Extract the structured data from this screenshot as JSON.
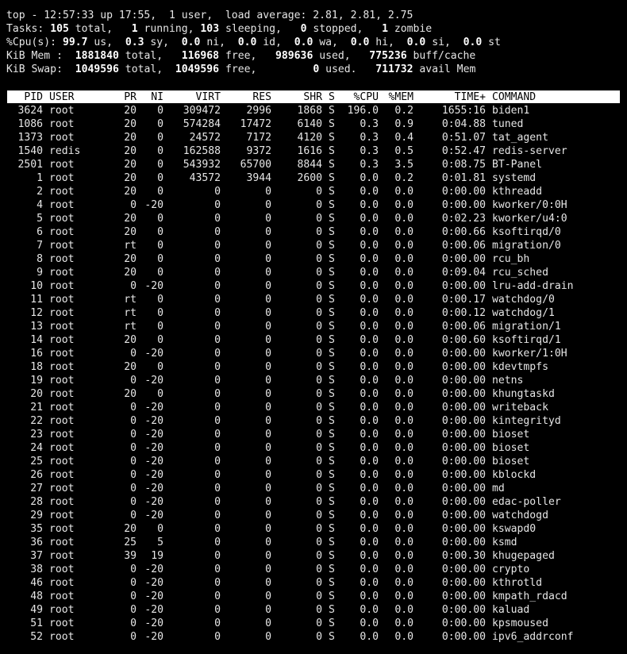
{
  "summary": {
    "line1": [
      {
        "t": "top - 12:57:33 up 17:55,  1 user,  load average: 2.81, 2.81, 2.75",
        "b": false
      }
    ],
    "line2": [
      {
        "t": "Tasks: ",
        "b": false
      },
      {
        "t": "105",
        "b": true
      },
      {
        "t": " total,   ",
        "b": false
      },
      {
        "t": "1",
        "b": true
      },
      {
        "t": " running, ",
        "b": false
      },
      {
        "t": "103",
        "b": true
      },
      {
        "t": " sleeping,   ",
        "b": false
      },
      {
        "t": "0",
        "b": true
      },
      {
        "t": " stopped,   ",
        "b": false
      },
      {
        "t": "1",
        "b": true
      },
      {
        "t": " zombie",
        "b": false
      }
    ],
    "line3": [
      {
        "t": "%Cpu(s): ",
        "b": false
      },
      {
        "t": "99.7",
        "b": true
      },
      {
        "t": " us,  ",
        "b": false
      },
      {
        "t": "0.3",
        "b": true
      },
      {
        "t": " sy,  ",
        "b": false
      },
      {
        "t": "0.0",
        "b": true
      },
      {
        "t": " ni,  ",
        "b": false
      },
      {
        "t": "0.0",
        "b": true
      },
      {
        "t": " id,  ",
        "b": false
      },
      {
        "t": "0.0",
        "b": true
      },
      {
        "t": " wa,  ",
        "b": false
      },
      {
        "t": "0.0",
        "b": true
      },
      {
        "t": " hi,  ",
        "b": false
      },
      {
        "t": "0.0",
        "b": true
      },
      {
        "t": " si,  ",
        "b": false
      },
      {
        "t": "0.0",
        "b": true
      },
      {
        "t": " st",
        "b": false
      }
    ],
    "line4": [
      {
        "t": "KiB Mem : ",
        "b": false
      },
      {
        "t": " 1881840",
        "b": true
      },
      {
        "t": " total,  ",
        "b": false
      },
      {
        "t": " 116968",
        "b": true
      },
      {
        "t": " free,  ",
        "b": false
      },
      {
        "t": " 989636",
        "b": true
      },
      {
        "t": " used,  ",
        "b": false
      },
      {
        "t": " 775236",
        "b": true
      },
      {
        "t": " buff/cache",
        "b": false
      }
    ],
    "line5": [
      {
        "t": "KiB Swap: ",
        "b": false
      },
      {
        "t": " 1049596",
        "b": true
      },
      {
        "t": " total, ",
        "b": false
      },
      {
        "t": " 1049596",
        "b": true
      },
      {
        "t": " free,  ",
        "b": false
      },
      {
        "t": "       0",
        "b": true
      },
      {
        "t": " used.  ",
        "b": false
      },
      {
        "t": " 711732",
        "b": true
      },
      {
        "t": " avail Mem",
        "b": false
      }
    ]
  },
  "columns": {
    "pid": "PID",
    "user": "USER",
    "pr": "PR",
    "ni": "NI",
    "virt": "VIRT",
    "res": "RES",
    "shr": "SHR",
    "s": "S",
    "cpu": "%CPU",
    "mem": "%MEM",
    "time": "TIME+",
    "command": "COMMAND"
  },
  "processes": [
    [
      "3624",
      "root",
      "20",
      "0",
      "309472",
      "2996",
      "1868",
      "S",
      "196.0",
      "0.2",
      "1655:16",
      "biden1"
    ],
    [
      "1086",
      "root",
      "20",
      "0",
      "574284",
      "17472",
      "6140",
      "S",
      "0.3",
      "0.9",
      "0:04.88",
      "tuned"
    ],
    [
      "1373",
      "root",
      "20",
      "0",
      "24572",
      "7172",
      "4120",
      "S",
      "0.3",
      "0.4",
      "0:51.07",
      "tat_agent"
    ],
    [
      "1540",
      "redis",
      "20",
      "0",
      "162588",
      "9372",
      "1616",
      "S",
      "0.3",
      "0.5",
      "0:52.47",
      "redis-server"
    ],
    [
      "2501",
      "root",
      "20",
      "0",
      "543932",
      "65700",
      "8844",
      "S",
      "0.3",
      "3.5",
      "0:08.75",
      "BT-Panel"
    ],
    [
      "1",
      "root",
      "20",
      "0",
      "43572",
      "3944",
      "2600",
      "S",
      "0.0",
      "0.2",
      "0:01.81",
      "systemd"
    ],
    [
      "2",
      "root",
      "20",
      "0",
      "0",
      "0",
      "0",
      "S",
      "0.0",
      "0.0",
      "0:00.00",
      "kthreadd"
    ],
    [
      "4",
      "root",
      "0",
      "-20",
      "0",
      "0",
      "0",
      "S",
      "0.0",
      "0.0",
      "0:00.00",
      "kworker/0:0H"
    ],
    [
      "5",
      "root",
      "20",
      "0",
      "0",
      "0",
      "0",
      "S",
      "0.0",
      "0.0",
      "0:02.23",
      "kworker/u4:0"
    ],
    [
      "6",
      "root",
      "20",
      "0",
      "0",
      "0",
      "0",
      "S",
      "0.0",
      "0.0",
      "0:00.66",
      "ksoftirqd/0"
    ],
    [
      "7",
      "root",
      "rt",
      "0",
      "0",
      "0",
      "0",
      "S",
      "0.0",
      "0.0",
      "0:00.06",
      "migration/0"
    ],
    [
      "8",
      "root",
      "20",
      "0",
      "0",
      "0",
      "0",
      "S",
      "0.0",
      "0.0",
      "0:00.00",
      "rcu_bh"
    ],
    [
      "9",
      "root",
      "20",
      "0",
      "0",
      "0",
      "0",
      "S",
      "0.0",
      "0.0",
      "0:09.04",
      "rcu_sched"
    ],
    [
      "10",
      "root",
      "0",
      "-20",
      "0",
      "0",
      "0",
      "S",
      "0.0",
      "0.0",
      "0:00.00",
      "lru-add-drain"
    ],
    [
      "11",
      "root",
      "rt",
      "0",
      "0",
      "0",
      "0",
      "S",
      "0.0",
      "0.0",
      "0:00.17",
      "watchdog/0"
    ],
    [
      "12",
      "root",
      "rt",
      "0",
      "0",
      "0",
      "0",
      "S",
      "0.0",
      "0.0",
      "0:00.12",
      "watchdog/1"
    ],
    [
      "13",
      "root",
      "rt",
      "0",
      "0",
      "0",
      "0",
      "S",
      "0.0",
      "0.0",
      "0:00.06",
      "migration/1"
    ],
    [
      "14",
      "root",
      "20",
      "0",
      "0",
      "0",
      "0",
      "S",
      "0.0",
      "0.0",
      "0:00.60",
      "ksoftirqd/1"
    ],
    [
      "16",
      "root",
      "0",
      "-20",
      "0",
      "0",
      "0",
      "S",
      "0.0",
      "0.0",
      "0:00.00",
      "kworker/1:0H"
    ],
    [
      "18",
      "root",
      "20",
      "0",
      "0",
      "0",
      "0",
      "S",
      "0.0",
      "0.0",
      "0:00.00",
      "kdevtmpfs"
    ],
    [
      "19",
      "root",
      "0",
      "-20",
      "0",
      "0",
      "0",
      "S",
      "0.0",
      "0.0",
      "0:00.00",
      "netns"
    ],
    [
      "20",
      "root",
      "20",
      "0",
      "0",
      "0",
      "0",
      "S",
      "0.0",
      "0.0",
      "0:00.00",
      "khungtaskd"
    ],
    [
      "21",
      "root",
      "0",
      "-20",
      "0",
      "0",
      "0",
      "S",
      "0.0",
      "0.0",
      "0:00.00",
      "writeback"
    ],
    [
      "22",
      "root",
      "0",
      "-20",
      "0",
      "0",
      "0",
      "S",
      "0.0",
      "0.0",
      "0:00.00",
      "kintegrityd"
    ],
    [
      "23",
      "root",
      "0",
      "-20",
      "0",
      "0",
      "0",
      "S",
      "0.0",
      "0.0",
      "0:00.00",
      "bioset"
    ],
    [
      "24",
      "root",
      "0",
      "-20",
      "0",
      "0",
      "0",
      "S",
      "0.0",
      "0.0",
      "0:00.00",
      "bioset"
    ],
    [
      "25",
      "root",
      "0",
      "-20",
      "0",
      "0",
      "0",
      "S",
      "0.0",
      "0.0",
      "0:00.00",
      "bioset"
    ],
    [
      "26",
      "root",
      "0",
      "-20",
      "0",
      "0",
      "0",
      "S",
      "0.0",
      "0.0",
      "0:00.00",
      "kblockd"
    ],
    [
      "27",
      "root",
      "0",
      "-20",
      "0",
      "0",
      "0",
      "S",
      "0.0",
      "0.0",
      "0:00.00",
      "md"
    ],
    [
      "28",
      "root",
      "0",
      "-20",
      "0",
      "0",
      "0",
      "S",
      "0.0",
      "0.0",
      "0:00.00",
      "edac-poller"
    ],
    [
      "29",
      "root",
      "0",
      "-20",
      "0",
      "0",
      "0",
      "S",
      "0.0",
      "0.0",
      "0:00.00",
      "watchdogd"
    ],
    [
      "35",
      "root",
      "20",
      "0",
      "0",
      "0",
      "0",
      "S",
      "0.0",
      "0.0",
      "0:00.00",
      "kswapd0"
    ],
    [
      "36",
      "root",
      "25",
      "5",
      "0",
      "0",
      "0",
      "S",
      "0.0",
      "0.0",
      "0:00.00",
      "ksmd"
    ],
    [
      "37",
      "root",
      "39",
      "19",
      "0",
      "0",
      "0",
      "S",
      "0.0",
      "0.0",
      "0:00.30",
      "khugepaged"
    ],
    [
      "38",
      "root",
      "0",
      "-20",
      "0",
      "0",
      "0",
      "S",
      "0.0",
      "0.0",
      "0:00.00",
      "crypto"
    ],
    [
      "46",
      "root",
      "0",
      "-20",
      "0",
      "0",
      "0",
      "S",
      "0.0",
      "0.0",
      "0:00.00",
      "kthrotld"
    ],
    [
      "48",
      "root",
      "0",
      "-20",
      "0",
      "0",
      "0",
      "S",
      "0.0",
      "0.0",
      "0:00.00",
      "kmpath_rdacd"
    ],
    [
      "49",
      "root",
      "0",
      "-20",
      "0",
      "0",
      "0",
      "S",
      "0.0",
      "0.0",
      "0:00.00",
      "kaluad"
    ],
    [
      "51",
      "root",
      "0",
      "-20",
      "0",
      "0",
      "0",
      "S",
      "0.0",
      "0.0",
      "0:00.00",
      "kpsmoused"
    ],
    [
      "52",
      "root",
      "0",
      "-20",
      "0",
      "0",
      "0",
      "S",
      "0.0",
      "0.0",
      "0:00.00",
      "ipv6_addrconf"
    ]
  ],
  "colors": {
    "background": "#000000",
    "text": "#e6e6e6",
    "highlight_text": "#ffffff",
    "header_bar": "#ffffff",
    "header_text": "#000000"
  }
}
